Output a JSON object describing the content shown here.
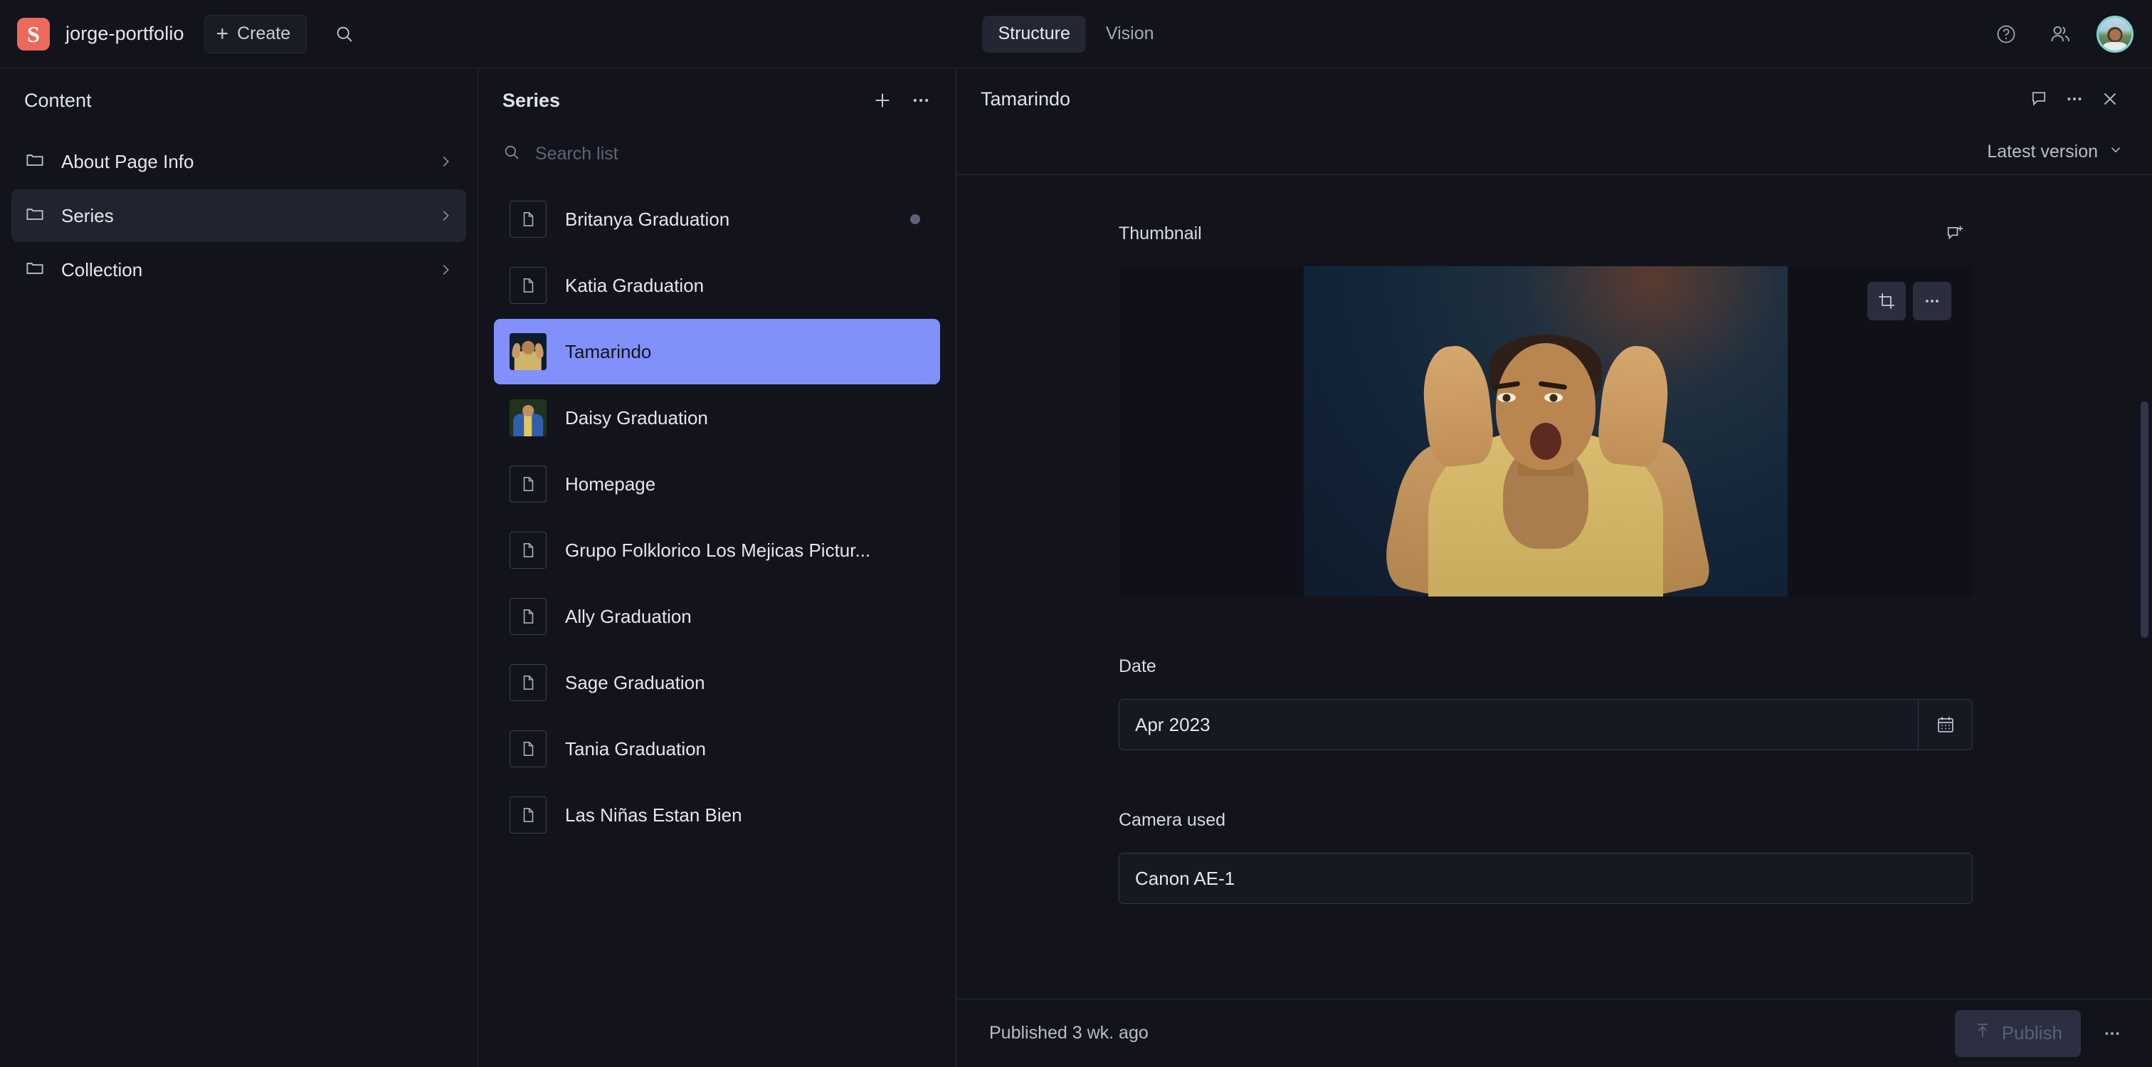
{
  "topbar": {
    "logo_letter": "S",
    "project_title": "jorge-portfolio",
    "create_label": "Create",
    "search_icon": "search-icon",
    "tabs": [
      {
        "label": "Structure",
        "active": true
      },
      {
        "label": "Vision",
        "active": false
      }
    ],
    "help_icon": "help-circle-icon",
    "users_icon": "users-icon",
    "avatar": "user-avatar"
  },
  "content_pane": {
    "title": "Content",
    "items": [
      {
        "label": "About Page Info",
        "icon": "folder-icon",
        "selected": false
      },
      {
        "label": "Series",
        "icon": "folder-icon",
        "selected": true
      },
      {
        "label": "Collection",
        "icon": "folder-icon",
        "selected": false
      }
    ]
  },
  "list_pane": {
    "title": "Series",
    "add_icon": "plus-icon",
    "more_icon": "ellipsis-icon",
    "search_placeholder": "Search list",
    "search_value": "",
    "documents": [
      {
        "label": "Britanya Graduation",
        "thumb": "file",
        "selected": false,
        "badge": "unpublished-dot"
      },
      {
        "label": "Katia Graduation",
        "thumb": "file",
        "selected": false,
        "badge": ""
      },
      {
        "label": "Tamarindo",
        "thumb": "image-tamarindo",
        "selected": true,
        "badge": ""
      },
      {
        "label": "Daisy Graduation",
        "thumb": "image-daisy",
        "selected": false,
        "badge": ""
      },
      {
        "label": "Homepage",
        "thumb": "file",
        "selected": false,
        "badge": ""
      },
      {
        "label": "Grupo Folklorico Los Mejicas Pictur...",
        "thumb": "file",
        "selected": false,
        "badge": ""
      },
      {
        "label": "Ally Graduation",
        "thumb": "file",
        "selected": false,
        "badge": ""
      },
      {
        "label": "Sage Graduation",
        "thumb": "file",
        "selected": false,
        "badge": ""
      },
      {
        "label": "Tania Graduation",
        "thumb": "file",
        "selected": false,
        "badge": ""
      },
      {
        "label": "Las Niñas Estan Bien",
        "thumb": "file",
        "selected": false,
        "badge": ""
      }
    ]
  },
  "document": {
    "title": "Tamarindo",
    "comment_icon": "comment-icon",
    "more_icon": "ellipsis-icon",
    "close_icon": "close-icon",
    "version_label": "Latest version",
    "version_chevron": "chevron-down-icon",
    "fields": {
      "thumbnail": {
        "label": "Thumbnail",
        "add_comment_icon": "add-comment-icon",
        "crop_icon": "crop-icon",
        "menu_icon": "ellipsis-icon"
      },
      "date": {
        "label": "Date",
        "value": "Apr 2023",
        "calendar_icon": "calendar-icon"
      },
      "camera": {
        "label": "Camera used",
        "value": "Canon AE-1"
      }
    },
    "footer": {
      "status": "Published 3 wk. ago",
      "publish_label": "Publish",
      "publish_icon": "publish-upload-icon",
      "more_icon": "ellipsis-icon"
    }
  },
  "colors": {
    "accent_selected": "#8290fb",
    "brand_logo": "#ec6a5c",
    "bg": "#13141b",
    "panel_border": "#252836",
    "avatar_ring": "#7fd4d4"
  }
}
